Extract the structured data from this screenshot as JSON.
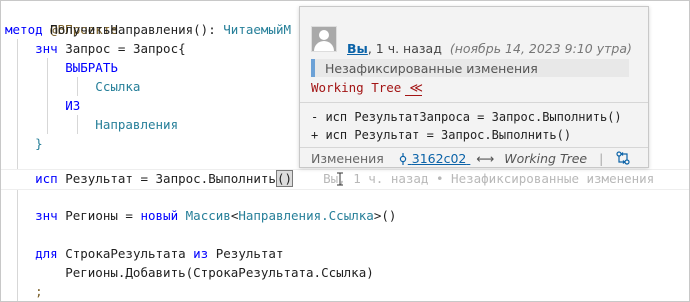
{
  "code": {
    "line1": "@ВПроекте",
    "line2_kw": "метод",
    "line2_name": " ПолучитьНаправления(): ",
    "line2_type": "ЧитаемыйМ",
    "line3_indent": "    ",
    "line3_kw": "знч",
    "line3_rest": " Запрос = Запрос{",
    "line4": "        ВЫБРАТЬ",
    "line5": "            Ссылка",
    "line6": "        ИЗ",
    "line7": "            Направления",
    "line8": "    }",
    "line9_indent": "    ",
    "line9_kw": "исп",
    "line9_rest": " Результат = Запрос.Выполнить",
    "line9_paren": "()",
    "line9_blame": "    Вы, 1 ч. назад • Незафиксированные изменения",
    "line10_indent": "    ",
    "line10_kw": "знч",
    "line10_a": " Регионы = ",
    "line10_kw2": "новый",
    "line10_b": " ",
    "line10_type": "Массив",
    "line10_lt": "<",
    "line10_type2": "Направления.Ссылка",
    "line10_gt": ">()",
    "line11_indent": "    ",
    "line11_kw": "для",
    "line11_a": " СтрокаРезультата ",
    "line11_kw2": "из",
    "line11_b": " Результат",
    "line12": "        Регионы.Добавить(СтрокаРезультата.Ссылка)",
    "line13": "    ;"
  },
  "hover": {
    "author": "Вы",
    "time": ", 1 ч. назад",
    "date": "(ноябрь 14, 2023 9:10 утра)",
    "status": "Незафиксированные изменения",
    "tree_name": "Working Tree",
    "tree_button": "≪",
    "diff_removed": "- исп РезультатЗапроса = Запрос.Выполнить()",
    "diff_added": "+ исп Результат = Запрос.Выполнить()",
    "changes_label": "Изменения",
    "commit_icon": "commit-icon",
    "commit_hash": "3162c02",
    "arrow": "⟷",
    "working_tree": "Working Tree",
    "pipe": "|",
    "compare_icon": "compare-changes-icon"
  },
  "colors": {
    "keyword": "#0000ff",
    "type": "#267f99",
    "link": "#0b63a8",
    "status_accent": "#6ca1d6",
    "tree_name": "#a31515"
  }
}
